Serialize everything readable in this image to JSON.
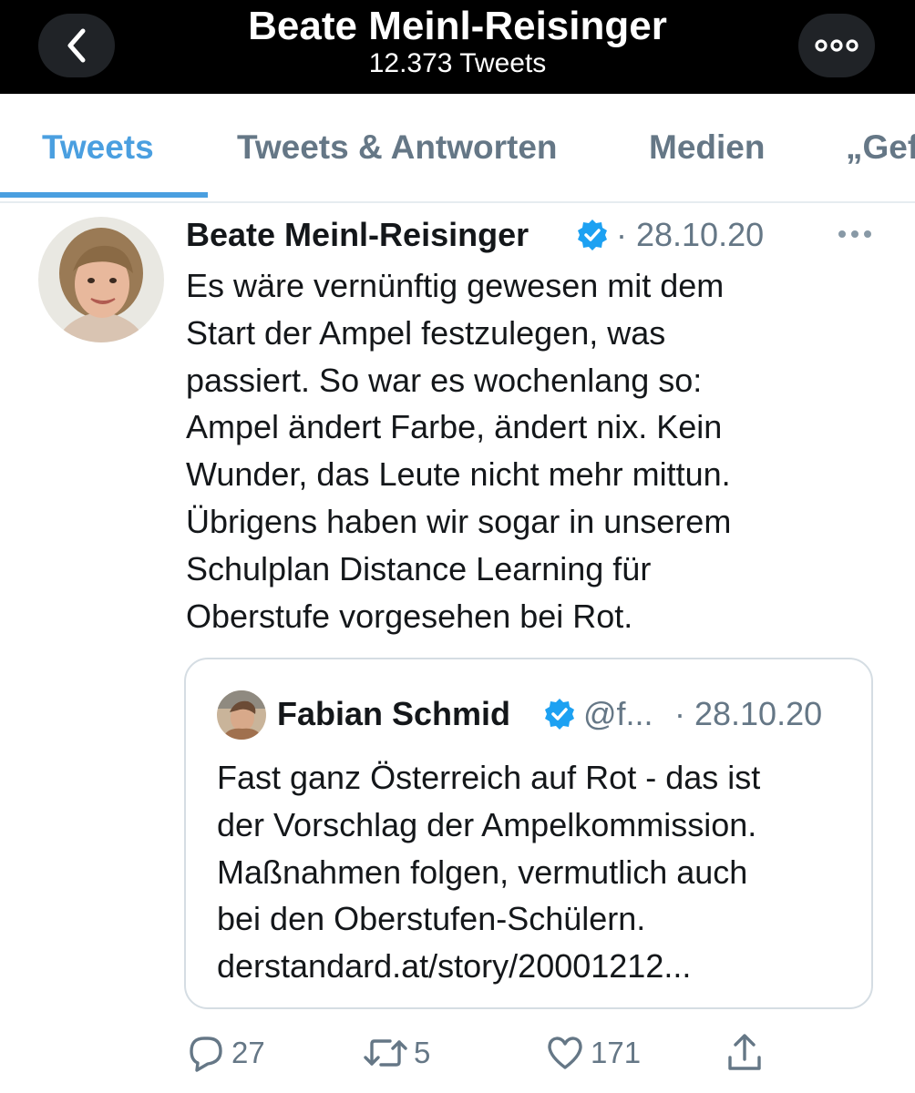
{
  "header": {
    "title": "Beate Meinl-Reisinger",
    "subtitle": "12.373 Tweets",
    "back_icon": "chevron-left-icon",
    "more_icon": "more-horizontal-icon"
  },
  "tabs": [
    {
      "label": "Tweets",
      "active": true
    },
    {
      "label": "Tweets & Antworten",
      "active": false
    },
    {
      "label": "Medien",
      "active": false
    },
    {
      "label": "„Gef",
      "active": false
    }
  ],
  "tweet": {
    "author": "Beate Meinl-Reisinger",
    "verified": true,
    "date": "· 28.10.20",
    "text": "Es wäre vernünftig gewesen mit dem\nStart der Ampel festzulegen, was\npassiert. So war es wochenlang so:\nAmpel ändert Farbe, ändert nix. Kein\nWunder, das Leute nicht mehr mittun.\nÜbrigens haben wir sogar in unserem\nSchulplan Distance Learning für\nOberstufe vorgesehen bei Rot.",
    "quote": {
      "author": "Fabian Schmid",
      "verified": true,
      "handle": "@f...",
      "date": "· 28.10.20",
      "text": "Fast ganz Österreich auf Rot - das ist\nder Vorschlag der Ampelkommission.\nMaßnahmen folgen, vermutlich auch\nbei den Oberstufen-Schülern.\nderstandard.at/story/20001212..."
    },
    "actions": {
      "replies": "27",
      "retweets": "5",
      "likes": "171"
    }
  },
  "colors": {
    "accent": "#4a9fe0",
    "verified": "#1da1f2",
    "muted": "#657786",
    "header_bg": "#000000"
  }
}
